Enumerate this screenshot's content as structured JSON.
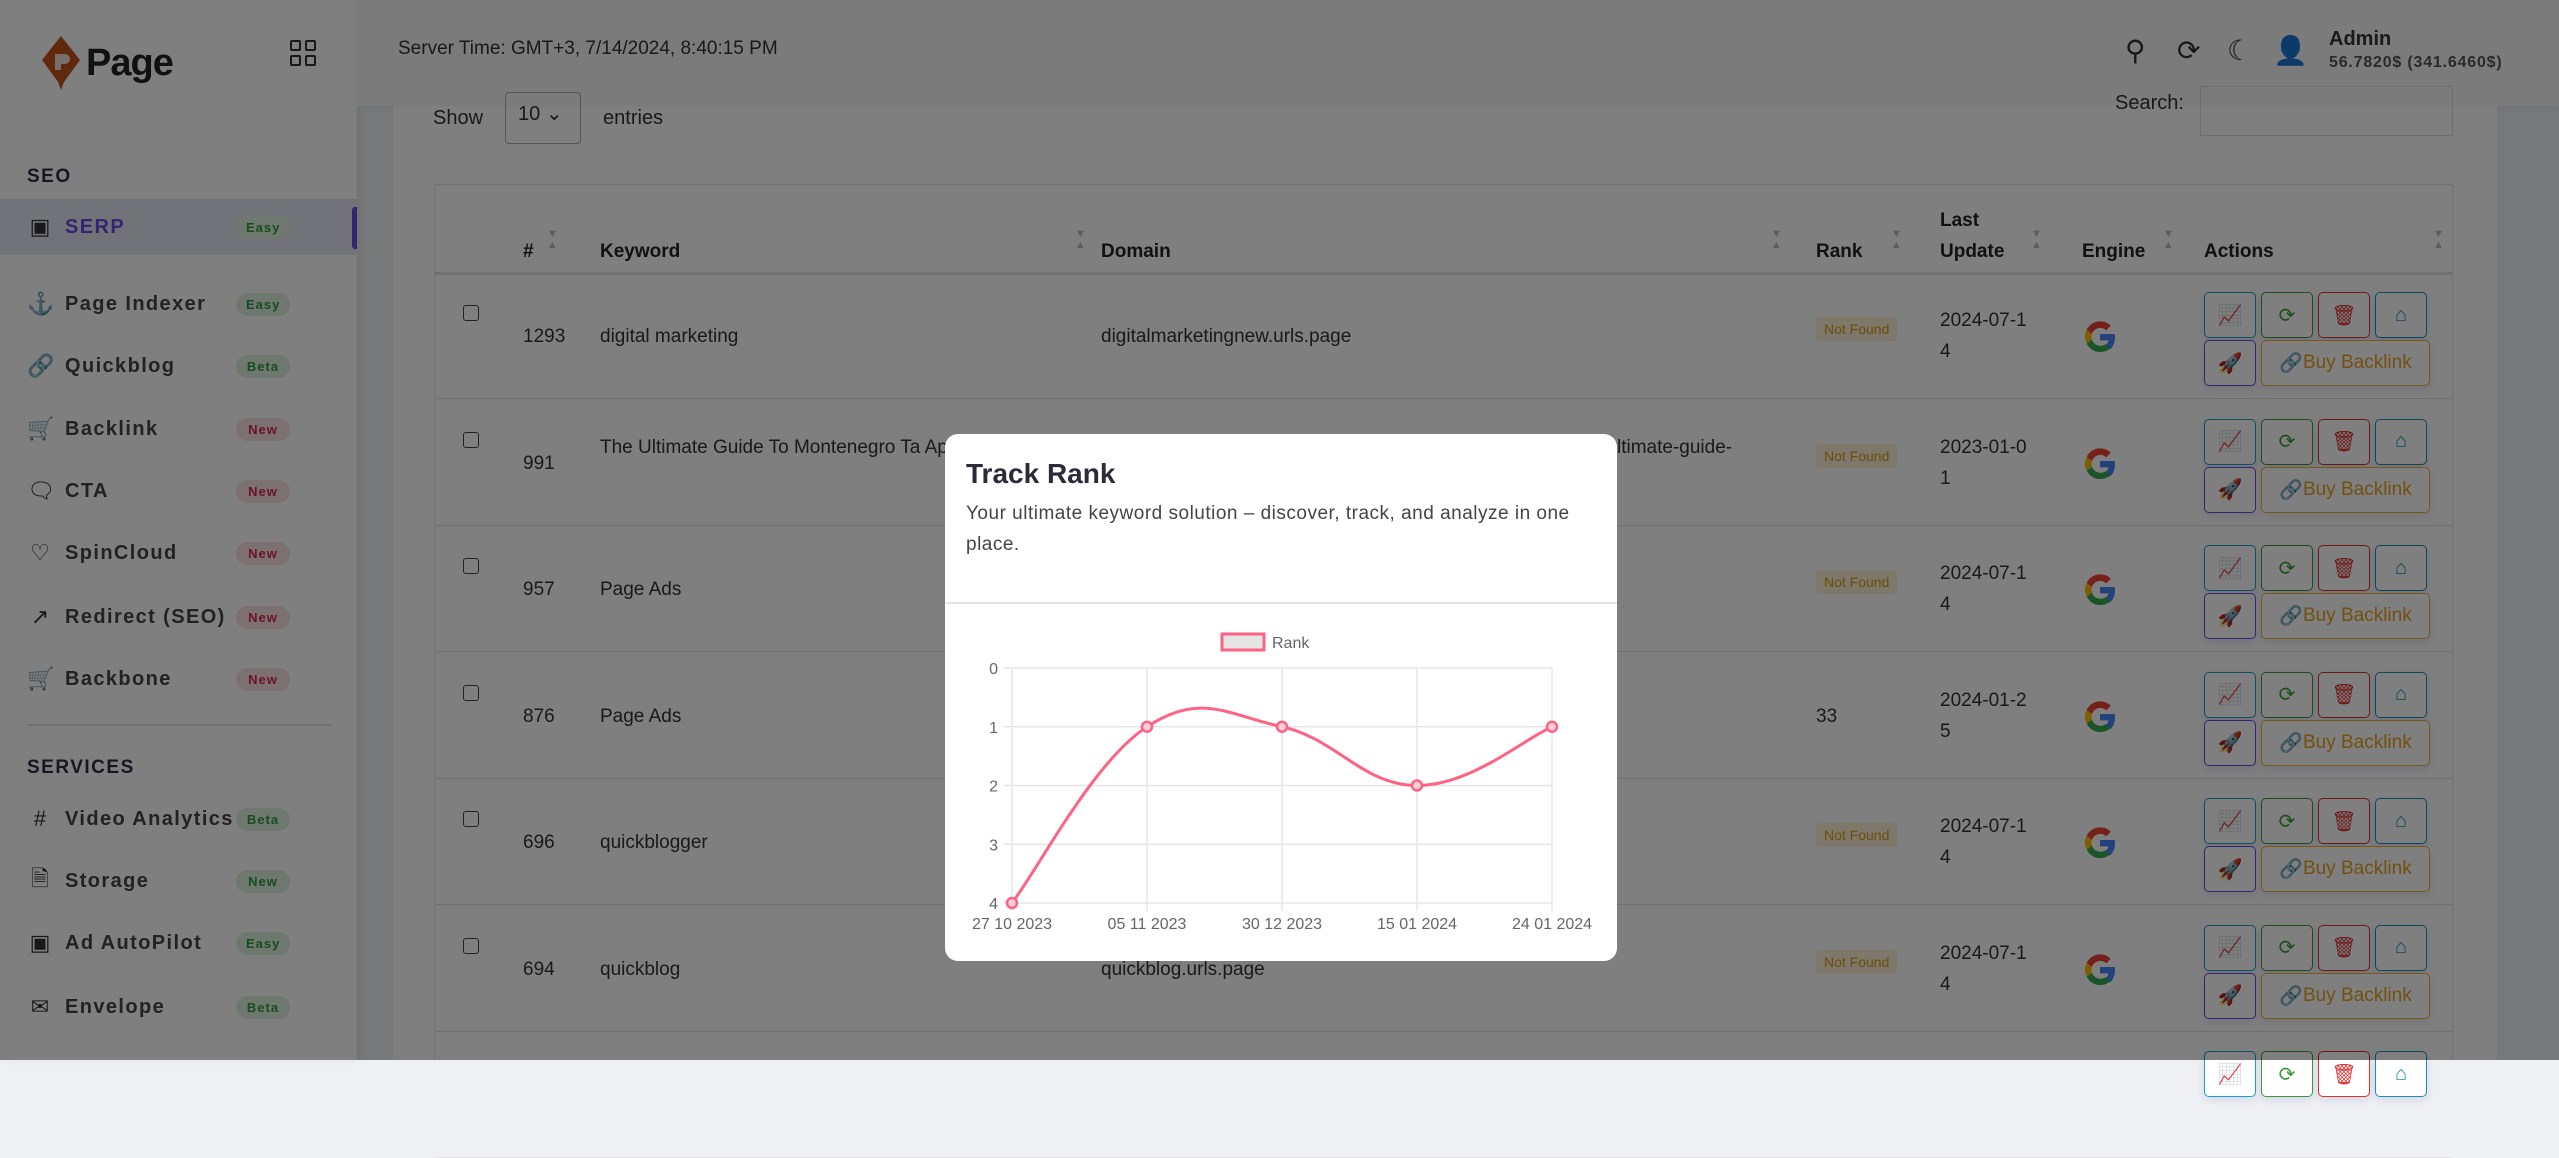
{
  "logo": {
    "text": "Page"
  },
  "sidebar": {
    "sections": [
      {
        "label": "SEO",
        "items": [
          {
            "label": "SERP",
            "badge": "Easy",
            "badge_color": "green",
            "icon": "chip-icon",
            "active": true
          },
          {
            "label": "Page Indexer",
            "badge": "Easy",
            "badge_color": "green",
            "icon": "anchor-icon"
          },
          {
            "label": "Quickblog",
            "badge": "Beta",
            "badge_color": "green",
            "icon": "link-icon"
          },
          {
            "label": "Backlink",
            "badge": "New",
            "badge_color": "red",
            "icon": "cart-icon"
          },
          {
            "label": "CTA",
            "badge": "New",
            "badge_color": "red",
            "icon": "chat-icon"
          },
          {
            "label": "SpinCloud",
            "badge": "New",
            "badge_color": "red",
            "icon": "heart-icon"
          },
          {
            "label": "Redirect (SEO)",
            "badge": "New",
            "badge_color": "red",
            "icon": "external-link-icon"
          },
          {
            "label": "Backbone",
            "badge": "New",
            "badge_color": "red",
            "icon": "cart-icon"
          }
        ]
      },
      {
        "label": "SERVICES",
        "items": [
          {
            "label": "Video Analytics",
            "badge": "Beta",
            "badge_color": "green",
            "icon": "hash-icon"
          },
          {
            "label": "Storage",
            "badge": "New",
            "badge_color": "green",
            "icon": "file-icon"
          },
          {
            "label": "Ad AutoPilot",
            "badge": "Easy",
            "badge_color": "green",
            "icon": "chip-icon"
          },
          {
            "label": "Envelope",
            "badge": "Beta",
            "badge_color": "green",
            "icon": "envelope-icon"
          }
        ]
      }
    ]
  },
  "header": {
    "server_time": "Server Time: GMT+3, 7/14/2024, 8:40:15 PM",
    "user": "Admin",
    "balance": "56.7820$ (341.6460$)"
  },
  "table_controls": {
    "show": "Show",
    "entries_value": "10",
    "entries": "entries",
    "search": "Search:"
  },
  "table": {
    "columns": [
      "#",
      "Keyword",
      "Domain",
      "Rank",
      "Last Update",
      "Engine",
      "Actions"
    ],
    "buy_label": "Buy Backlink",
    "rows": [
      {
        "id": "1293",
        "keyword": "digital marketing",
        "domain": "digitalmarketingnew.urls.page",
        "rank": "Not Found",
        "last_update": "2024-07-14"
      },
      {
        "id": "991",
        "keyword": "The Ultimate Guide To Montenegro Ta App",
        "domain": "ltimate-guide-",
        "rank": "Not Found",
        "last_update": "2023-01-01"
      },
      {
        "id": "957",
        "keyword": "Page Ads",
        "domain": "",
        "rank": "Not Found",
        "last_update": "2024-07-14"
      },
      {
        "id": "876",
        "keyword": "Page Ads",
        "domain": "",
        "rank": "33",
        "last_update": "2024-01-25"
      },
      {
        "id": "696",
        "keyword": "quickblogger",
        "domain": "",
        "rank": "Not Found",
        "last_update": "2024-07-14"
      },
      {
        "id": "694",
        "keyword": "quickblog",
        "domain": "quickblog.urls.page",
        "rank": "Not Found",
        "last_update": "2024-07-14"
      }
    ]
  },
  "modal": {
    "title": "Track Rank",
    "subtitle": "Your ultimate keyword solution – discover, track, and analyze in one place."
  },
  "chart_data": {
    "type": "line",
    "categories": [
      "27 10 2023",
      "05 11 2023",
      "30 12 2023",
      "15 01 2024",
      "24 01 2024"
    ],
    "series": [
      {
        "name": "Rank",
        "values": [
          4,
          1,
          1,
          2,
          1
        ],
        "color": "#ff6384"
      }
    ],
    "ylim": [
      0,
      4
    ],
    "y_reversed": true,
    "yticks": [
      "0",
      "1",
      "2",
      "3",
      "4"
    ],
    "grid": true,
    "legend": "top",
    "smooth": true
  }
}
